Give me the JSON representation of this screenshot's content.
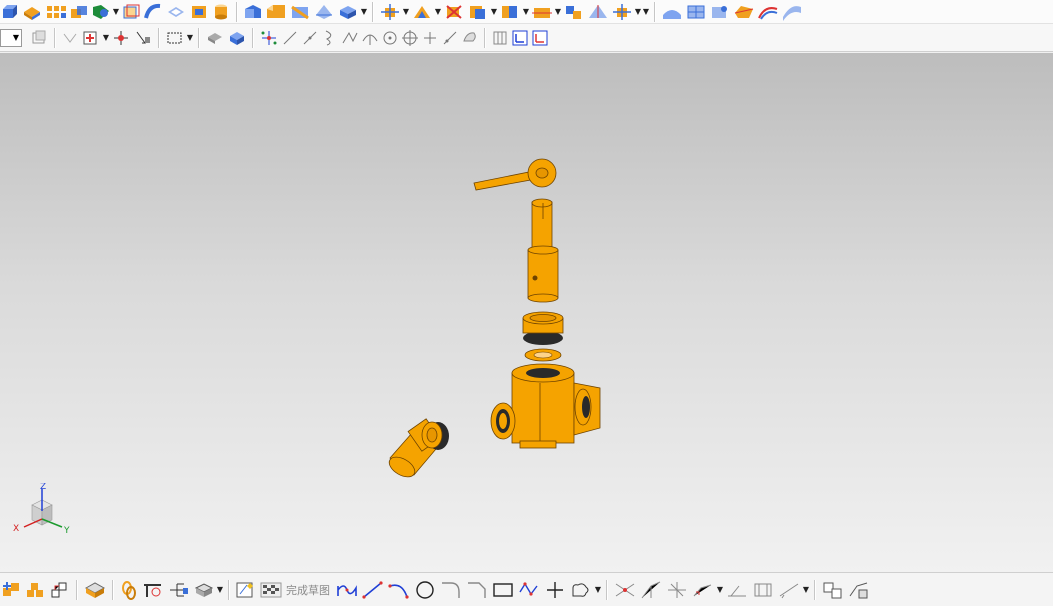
{
  "colors": {
    "part_fill": "#f5a300",
    "part_edge": "#6e4300",
    "gasket": "#2a2a2a",
    "axis_x": "#d32020",
    "axis_y": "#1b9a2e",
    "axis_z": "#1f3fd6",
    "toolbar_icon_blue": "#3a6fd8",
    "toolbar_icon_orange": "#f0a020"
  },
  "sketch_toolbar": {
    "finish_sketch_label": "完成草图"
  },
  "view_triad": {
    "x_label": "X",
    "y_label": "Y",
    "z_label": "Z"
  },
  "model": {
    "name_visible": false,
    "parts": [
      "handle",
      "stem",
      "gland-nut",
      "gasket-ring",
      "valve-body",
      "elbow-fitting"
    ]
  }
}
